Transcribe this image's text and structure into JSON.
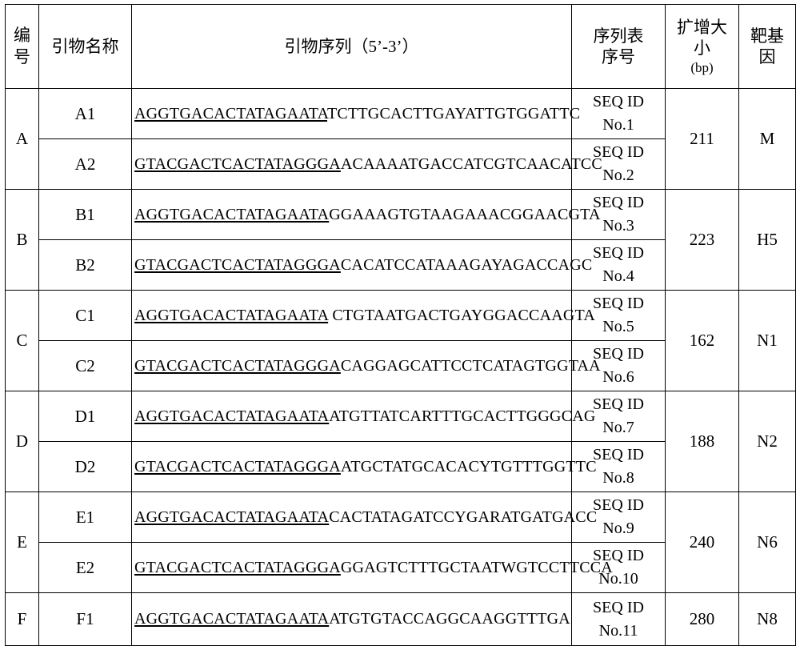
{
  "table": {
    "headers": {
      "id": "编号",
      "primer_name": "引物名称",
      "primer_sequence": "引物序列（5’-3’）",
      "seq_listing_line1": "序列表",
      "seq_listing_line2": "序号",
      "amplicon_line1": "扩增大",
      "amplicon_line2": "小",
      "amplicon_line3": "(bp)",
      "target_gene_line1": "靶基",
      "target_gene_line2": "因"
    },
    "groups": [
      {
        "id": "A",
        "size": "211",
        "gene": "M",
        "primers": [
          {
            "name": "A1",
            "tag": "AGGTGACACTATAGAATA",
            "body": "TCTTGCACTTGAYATTGTGGATTC",
            "seq_id_line1": "SEQ ID",
            "seq_id_line2": "No.1"
          },
          {
            "name": "A2",
            "tag": "GTACGACTCACTATAGGGA",
            "body": "ACAAAATGACCATCGTCAACATCC",
            "seq_id_line1": "SEQ ID",
            "seq_id_line2": "No.2"
          }
        ]
      },
      {
        "id": "B",
        "size": "223",
        "gene": "H5",
        "primers": [
          {
            "name": "B1",
            "tag": "AGGTGACACTATAGAATA",
            "body": "GGAAAGTGTAAGAAACGGAACGTA",
            "seq_id_line1": "SEQ ID",
            "seq_id_line2": "No.3"
          },
          {
            "name": "B2",
            "tag": "GTACGACTCACTATAGGGA",
            "body": "CACATCCATAAAGAYAGACCAGC",
            "seq_id_line1": "SEQ ID",
            "seq_id_line2": "No.4"
          }
        ]
      },
      {
        "id": "C",
        "size": "162",
        "gene": "N1",
        "primers": [
          {
            "name": "C1",
            "tag": "AGGTGACACTATAGAATA",
            "body": " CTGTAATGACTGAYGGACCAAGTA",
            "seq_id_line1": "SEQ ID",
            "seq_id_line2": "No.5"
          },
          {
            "name": "C2",
            "tag": "GTACGACTCACTATAGGGA",
            "body": "CAGGAGCATTCCTCATAGTGGTAA",
            "seq_id_line1": "SEQ ID",
            "seq_id_line2": "No.6"
          }
        ]
      },
      {
        "id": "D",
        "size": "188",
        "gene": "N2",
        "primers": [
          {
            "name": "D1",
            "tag": "AGGTGACACTATAGAATA",
            "body": "ATGTTATCARTTTGCACTTGGGCAG",
            "seq_id_line1": "SEQ ID",
            "seq_id_line2": "No.7"
          },
          {
            "name": "D2",
            "tag": "GTACGACTCACTATAGGGA",
            "body": "ATGCTATGCACACYTGTTTGGTTC",
            "seq_id_line1": "SEQ ID",
            "seq_id_line2": "No.8"
          }
        ]
      },
      {
        "id": "E",
        "size": "240",
        "gene": "N6",
        "primers": [
          {
            "name": "E1",
            "tag": "AGGTGACACTATAGAATA",
            "body": "CACTATAGATCCYGARATGATGACC",
            "seq_id_line1": "SEQ ID",
            "seq_id_line2": "No.9"
          },
          {
            "name": "E2",
            "tag": "GTACGACTCACTATAGGGA",
            "body": "GGAGTCTTTGCTAATWGTCCTTCCA",
            "seq_id_line1": "SEQ ID",
            "seq_id_line2": "No.10"
          }
        ]
      },
      {
        "id": "F",
        "size": "280",
        "gene": "N8",
        "primers": [
          {
            "name": "F1",
            "tag": "AGGTGACACTATAGAATA",
            "body": "ATGTGTACCAGGCAAGGTTTGA",
            "seq_id_line1": "SEQ ID",
            "seq_id_line2": "No.11"
          }
        ]
      }
    ]
  }
}
